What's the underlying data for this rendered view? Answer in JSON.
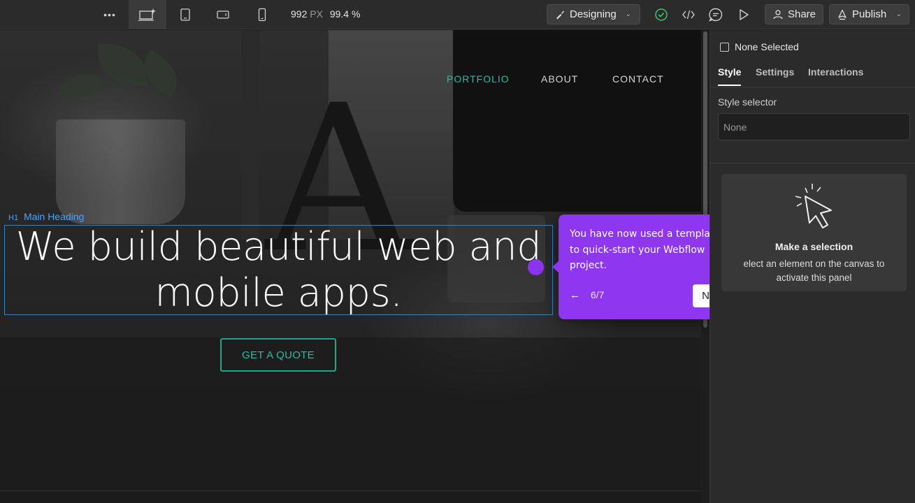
{
  "toolbar": {
    "more_icon": "more-horizontal-icon",
    "breakpoints": [
      {
        "name": "desktop",
        "icon": "desktop-star-icon",
        "active": true
      },
      {
        "name": "tablet",
        "icon": "tablet-icon",
        "active": false
      },
      {
        "name": "mobile-landscape",
        "icon": "mobile-landscape-icon",
        "active": false
      },
      {
        "name": "mobile-portrait",
        "icon": "mobile-portrait-icon",
        "active": false
      }
    ],
    "width_value": "992",
    "width_unit": "PX",
    "zoom": "99.4 %",
    "mode_label": "Designing",
    "share_label": "Share",
    "publish_label": "Publish"
  },
  "canvas": {
    "nav": [
      {
        "label": "PORTFOLIO",
        "active": true
      },
      {
        "label": "ABOUT",
        "active": false
      },
      {
        "label": "CONTACT",
        "active": false
      }
    ],
    "selected_tag": "H1",
    "selected_name": "Main Heading",
    "heading_line1": "We build beautiful web and",
    "heading_line2": "mobile apps.",
    "cta_label": "GET A QUOTE",
    "accent_color": "#2dbba0",
    "selection_color": "#3b82c4"
  },
  "panel": {
    "none_selected": "None Selected",
    "tabs": [
      {
        "label": "Style",
        "active": true
      },
      {
        "label": "Settings",
        "active": false
      },
      {
        "label": "Interactions",
        "active": false
      }
    ],
    "style_selector_label": "Style selector",
    "style_selector_value": "None",
    "empty_title": "Make a selection",
    "empty_desc_line1": "elect an element on the canvas to",
    "empty_desc_line2": "activate this panel"
  },
  "tour": {
    "text": "You have now used a template to quick-start your Webflow project.",
    "step": "6/7",
    "next_label": "Next",
    "color": "#8f36f0"
  }
}
